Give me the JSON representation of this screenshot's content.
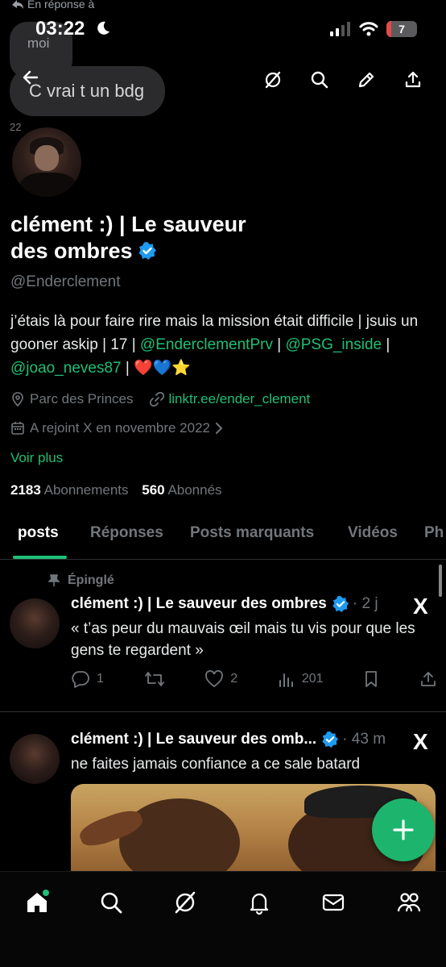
{
  "overlay": {
    "reply_context": "En réponse à",
    "small_bubble_text": "moi",
    "big_bubble_text": "C vrai t un bdg",
    "small_number": "22"
  },
  "status_bar": {
    "time": "03:22",
    "battery_level": "7",
    "battery_fill_fraction": 0.07
  },
  "profile": {
    "name_line1": "clément :) | Le sauveur",
    "name_line2": "des ombres",
    "handle": "@Enderclement",
    "bio_text1": "j’étais là pour faire rire mais la mission était difficile | jsuis un gooner askip | 17 | ",
    "bio_link1": "@EnderclementPrv",
    "bio_sep1": " | ",
    "bio_link2": "@PSG_inside",
    "bio_sep2": " | ",
    "bio_link3": "@joao_neves87",
    "bio_emoji": " | ❤️💙⭐",
    "location": "Parc des Princes",
    "website": "linktr.ee/ender_clement",
    "joined": "A rejoint X en novembre 2022",
    "see_more": "Voir plus",
    "following_count": "2183",
    "following_label": "Abonnements",
    "followers_count": "560",
    "followers_label": "Abonnés"
  },
  "tabs": [
    "posts",
    "Réponses",
    "Posts marquants",
    "Vidéos",
    "Ph"
  ],
  "tweets": [
    {
      "pinned_label": "Épinglé",
      "name": "clément :) | Le sauveur des ombres",
      "time": "· 2 j",
      "text": "« t’as peur du mauvais œil mais tu vis pour que les gens te regardent »",
      "replies": "1",
      "likes": "2",
      "views": "201"
    },
    {
      "name": "clément :) | Le sauveur des omb...",
      "time": "· 43 m",
      "text": "ne faites jamais confiance a ce sale batard"
    }
  ],
  "x_logo": "X",
  "colors": {
    "accent": "#1fbf76",
    "muted": "#71767b",
    "verified": "#1d9bf0"
  }
}
